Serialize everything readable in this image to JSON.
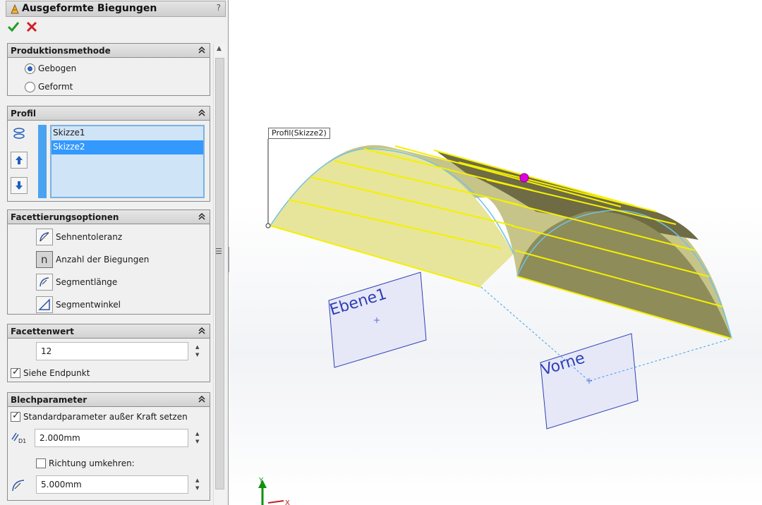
{
  "title": "Ausgeformte Biegungen",
  "help": "?",
  "groups": {
    "production": {
      "header": "Produktionsmethode",
      "options": [
        "Gebogen",
        "Geformt"
      ],
      "selected": "Gebogen"
    },
    "profile": {
      "header": "Profil",
      "items": [
        "Skizze1",
        "Skizze2"
      ],
      "selected": "Skizze2"
    },
    "facets": {
      "header": "Facettierungsoptionen",
      "options": [
        "Sehnentoleranz",
        "Anzahl der Biegungen",
        "Segmentlänge",
        "Segmentwinkel"
      ],
      "selected": "Anzahl der Biegungen",
      "selected_glyph": "n"
    },
    "facet_value": {
      "header": "Facettenwert",
      "value": "12",
      "check_label": "Siehe Endpunkt"
    },
    "sheet_params": {
      "header": "Blechparameter",
      "override_label": "Standardparameter außer Kraft setzen",
      "thickness": "2.000mm",
      "thickness_icon_text": "D1",
      "reverse_label": "Richtung umkehren:",
      "radius": "5.000mm"
    }
  },
  "viewport": {
    "callout": "Profil(Skizze2)",
    "plane1": "Ebene1",
    "plane2": "Vorne",
    "axis_y": "Y",
    "axis_x": "X"
  },
  "colors": {
    "accent": "#3399ff",
    "surface": "#e8e69a",
    "edge": "#f5f000",
    "plane": "#e6e8f8",
    "plane_border": "#2f3fb5",
    "handle": "#e000e0"
  }
}
